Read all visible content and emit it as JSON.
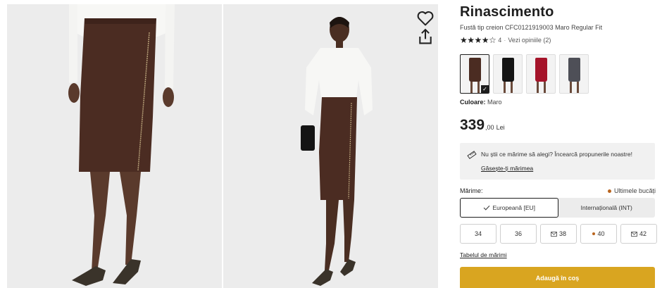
{
  "product": {
    "brand": "Rinascimento",
    "subtitle": "Fustă tip creion CFC0121919003 Maro Regular Fit",
    "rating": {
      "stars": "★★★★☆",
      "value": "4",
      "separator": "·",
      "reviews_link": "Vezi opiniile (2)"
    },
    "swatches": [
      {
        "name": "Maro",
        "color": "#4b2c22",
        "selected": true
      },
      {
        "name": "Negru",
        "color": "#141414",
        "selected": false
      },
      {
        "name": "Roșu",
        "color": "#a5142a",
        "selected": false
      },
      {
        "name": "Gri",
        "color": "#4e4f57",
        "selected": false
      }
    ],
    "color": {
      "label": "Culoare:",
      "value": "Maro"
    },
    "price": {
      "integer": "339",
      "decimals": ",00",
      "currency": "Lei"
    }
  },
  "size_help": {
    "message": "Nu știi ce mărime să alegi? Încearcă propunerile noastre!",
    "link": "Găsește-ți mărimea"
  },
  "sizes": {
    "label": "Mărime:",
    "availability": "Ultimele bucăți",
    "systems": [
      {
        "label": "Europeană [EU]",
        "active": true
      },
      {
        "label": "Internațională (INT)",
        "active": false
      }
    ],
    "options": [
      {
        "label": "34",
        "state": "available"
      },
      {
        "label": "36",
        "state": "available"
      },
      {
        "label": "38",
        "state": "notify"
      },
      {
        "label": "40",
        "state": "last"
      },
      {
        "label": "42",
        "state": "notify"
      }
    ],
    "table_link": "Tabelul de mărimi"
  },
  "cta": {
    "add_to_cart": "Adaugă în coș"
  },
  "colors": {
    "accent": "#d9a520",
    "low_stock": "#b9651f",
    "text": "#1e1e1e"
  },
  "icons": [
    "heart-icon",
    "share-icon",
    "ruler-icon",
    "check-icon",
    "mail-icon"
  ]
}
